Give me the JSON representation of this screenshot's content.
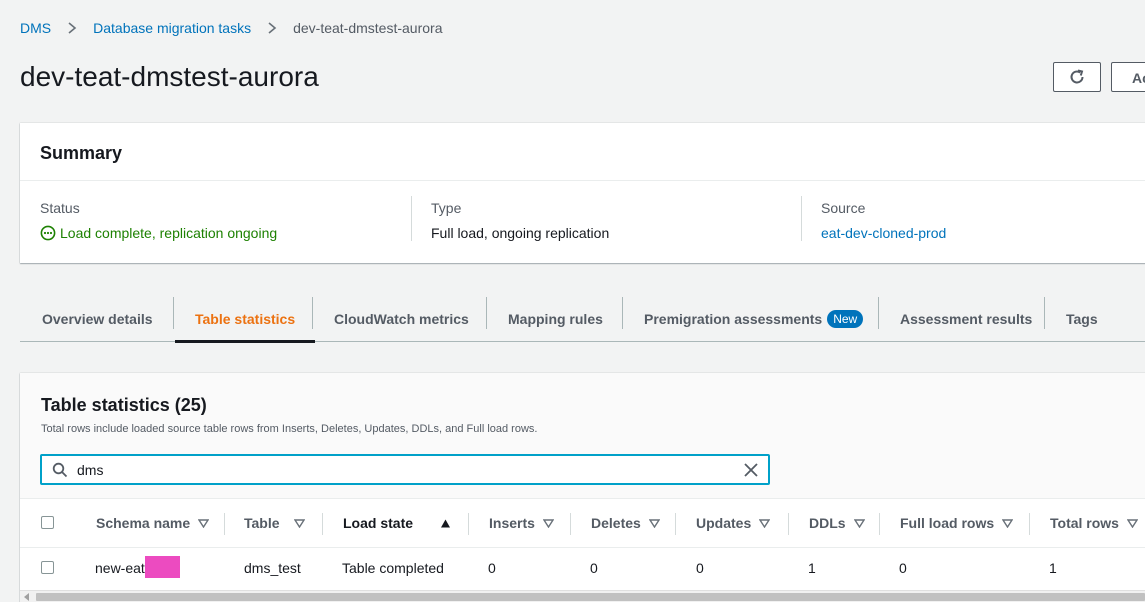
{
  "breadcrumb": {
    "items": [
      "DMS",
      "Database migration tasks"
    ],
    "current": "dev-teat-dmstest-aurora"
  },
  "page": {
    "title": "dev-teat-dmstest-aurora",
    "actions_label": "Ac"
  },
  "summary": {
    "title": "Summary",
    "status_label": "Status",
    "status_value": "Load complete, replication ongoing",
    "type_label": "Type",
    "type_value": "Full load, ongoing replication",
    "source_label": "Source",
    "source_value": "eat-dev-cloned-prod"
  },
  "tabs": [
    {
      "label": "Overview details",
      "active": false
    },
    {
      "label": "Table statistics",
      "active": true
    },
    {
      "label": "CloudWatch metrics",
      "active": false
    },
    {
      "label": "Mapping rules",
      "active": false
    },
    {
      "label": "Premigration assessments",
      "badge": "New",
      "active": false
    },
    {
      "label": "Assessment results",
      "active": false
    },
    {
      "label": "Tags",
      "active": false
    }
  ],
  "table": {
    "title": "Table statistics (25)",
    "description": "Total rows include loaded source table rows from Inserts, Deletes, Updates, DDLs, and Full load rows.",
    "search_value": "dms",
    "columns": [
      "Schema name",
      "Table",
      "Load state",
      "Inserts",
      "Deletes",
      "Updates",
      "DDLs",
      "Full load rows",
      "Total rows"
    ],
    "rows": [
      [
        "new-eat",
        "dms_test",
        "Table completed",
        "0",
        "0",
        "0",
        "1",
        "0",
        "1"
      ]
    ]
  },
  "colors": {
    "link": "#0073bb",
    "active_tab": "#ec7211",
    "status_ok": "#1d8102",
    "search_focus": "#00a1c9",
    "redaction": "#ec4bc0"
  }
}
